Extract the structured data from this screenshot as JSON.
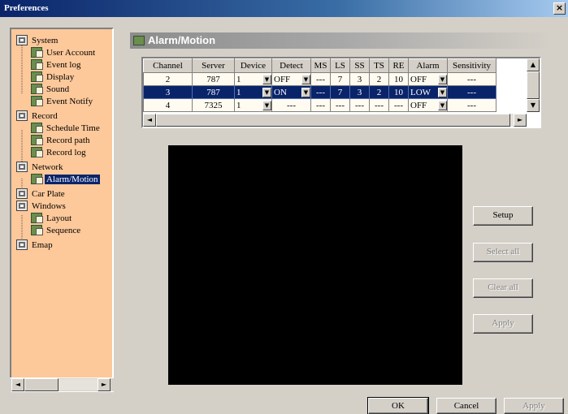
{
  "window": {
    "title": "Preferences",
    "close_glyph": "×"
  },
  "tree": {
    "items": [
      {
        "label": "System",
        "icon": "folder-icon",
        "level": 0
      },
      {
        "label": "User Account",
        "icon": "page-icon",
        "level": 1
      },
      {
        "label": "Event log",
        "icon": "page-icon",
        "level": 1
      },
      {
        "label": "Display",
        "icon": "page-icon",
        "level": 1
      },
      {
        "label": "Sound",
        "icon": "page-icon",
        "level": 1
      },
      {
        "label": "Event Notify",
        "icon": "page-icon",
        "level": 1
      },
      {
        "label": "Record",
        "icon": "folder-icon",
        "level": 0
      },
      {
        "label": "Schedule Time",
        "icon": "page-icon",
        "level": 1
      },
      {
        "label": "Record path",
        "icon": "page-icon",
        "level": 1
      },
      {
        "label": "Record log",
        "icon": "page-icon",
        "level": 1
      },
      {
        "label": "Network",
        "icon": "folder-icon",
        "level": 0
      },
      {
        "label": "Alarm/Motion",
        "icon": "page-icon",
        "level": 1,
        "selected": true
      },
      {
        "label": "Car Plate",
        "icon": "folder-icon",
        "level": 0
      },
      {
        "label": "Windows",
        "icon": "folder-icon",
        "level": 0
      },
      {
        "label": "Layout",
        "icon": "page-icon",
        "level": 1
      },
      {
        "label": "Sequence",
        "icon": "page-icon",
        "level": 1
      },
      {
        "label": "Emap",
        "icon": "folder-icon",
        "level": 0
      }
    ]
  },
  "panel": {
    "title": "Alarm/Motion"
  },
  "grid": {
    "columns": [
      "Channel",
      "Server",
      "Device",
      "Detect",
      "MS",
      "LS",
      "SS",
      "TS",
      "RE",
      "Alarm",
      "Sensitivity"
    ],
    "rows": [
      {
        "cells": [
          "2",
          "787",
          "1",
          "OFF",
          "---",
          "7",
          "3",
          "2",
          "10",
          "OFF",
          "---"
        ],
        "selected": false
      },
      {
        "cells": [
          "3",
          "787",
          "1",
          "ON",
          "---",
          "7",
          "3",
          "2",
          "10",
          "LOW",
          "---"
        ],
        "selected": true
      },
      {
        "cells": [
          "4",
          "7325",
          "1",
          "---",
          "---",
          "---",
          "---",
          "---",
          "---",
          "OFF",
          "---"
        ],
        "selected": false
      }
    ]
  },
  "side_buttons": {
    "setup": "Setup",
    "select_all": "Select all",
    "clear_all": "Clear all",
    "apply": "Apply"
  },
  "footer": {
    "ok": "OK",
    "cancel": "Cancel",
    "apply": "Apply"
  },
  "scroll_glyphs": {
    "left": "◄",
    "right": "►",
    "up": "▲",
    "down": "▼"
  }
}
